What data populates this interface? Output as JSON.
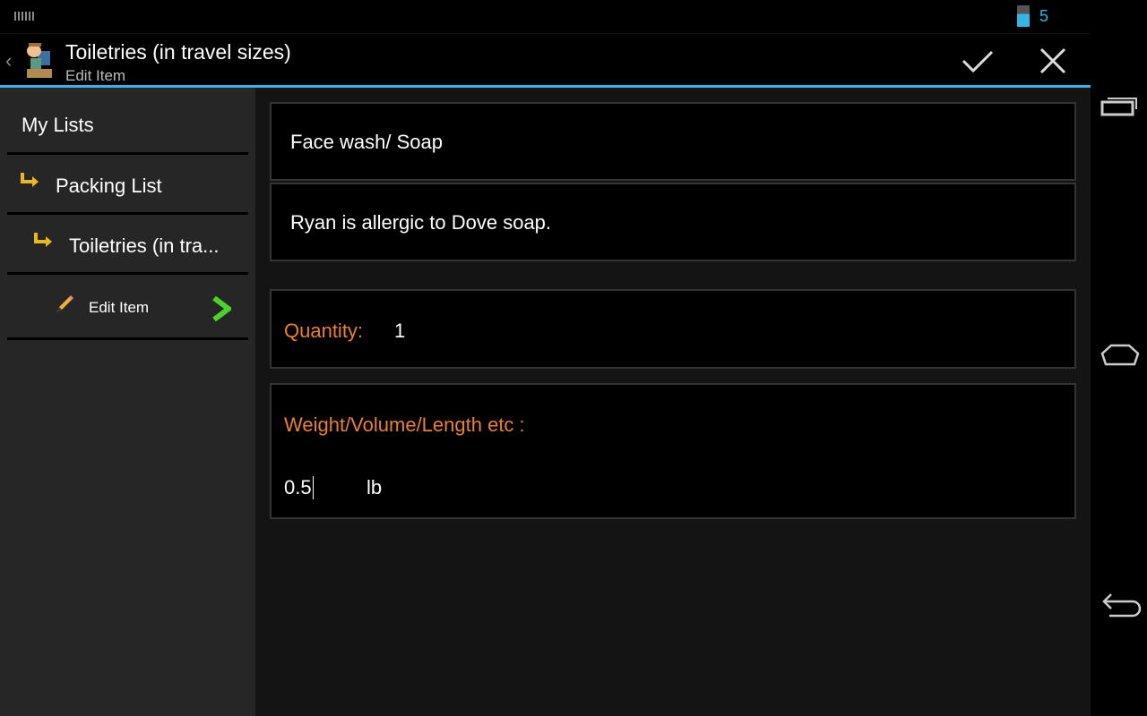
{
  "status": {
    "clock": "5"
  },
  "actionbar": {
    "title": "Toiletries (in travel sizes)",
    "subtitle": "Edit Item",
    "accept_icon": "check-icon",
    "cancel_icon": "close-icon"
  },
  "sidebar": {
    "items": [
      {
        "label": "My Lists"
      },
      {
        "label": "Packing List"
      },
      {
        "label": "Toiletries (in tra..."
      },
      {
        "label": "Edit Item"
      }
    ]
  },
  "form": {
    "name": "Face wash/ Soap",
    "note": "Ryan is allergic to Dove soap.",
    "quantity_label": "Quantity:",
    "quantity_value": "1",
    "measure_label": "Weight/Volume/Length etc :",
    "measure_value": "0.5",
    "measure_unit": "lb"
  },
  "colors": {
    "accent": "#33b5e5",
    "label": "#e8822e",
    "arrow": "#e8b820",
    "chevron": "#4cd12a"
  }
}
